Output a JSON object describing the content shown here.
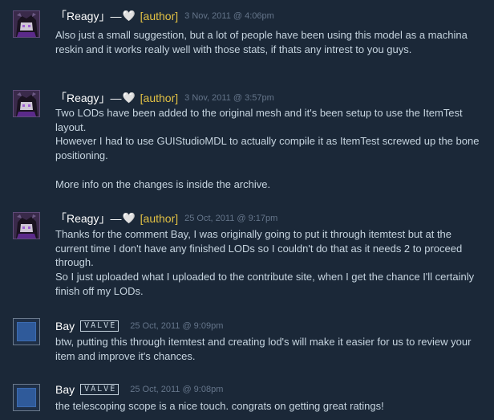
{
  "comments": [
    {
      "author": "「Reagy」―",
      "heart": "🤍",
      "tag": "[author]",
      "date": "3 Nov, 2011 @ 4:06pm",
      "text": "Also just a small suggestion, but a lot of people have been using this model as a machina reskin and it works really well with those stats, if thats any intrest to you guys."
    },
    {
      "author": "「Reagy」―",
      "heart": "🤍",
      "tag": "[author]",
      "date": "3 Nov, 2011 @ 3:57pm",
      "text": "Two LODs have been added to the original mesh and it's been setup to use the ItemTest layout.\nHowever I had to use GUIStudioMDL to actually compile it as ItemTest screwed up the bone positioning.\n\nMore info on the changes is inside the archive."
    },
    {
      "author": "「Reagy」―",
      "heart": "🤍",
      "tag": "[author]",
      "date": "25 Oct, 2011 @ 9:17pm",
      "text": "Thanks for the comment Bay, I was originally going to put it through itemtest but at the current time I don't have any finished LODs so I couldn't do that as it needs 2 to proceed through.\nSo I just uploaded what I uploaded to the contribute site, when I get the chance I'll certainly finish off my LODs."
    },
    {
      "author": "Bay",
      "badge": "VALVE",
      "date": "25 Oct, 2011 @ 9:09pm",
      "text": "btw, putting this through itemtest and creating lod's will make it easier for us to review your item and improve it's chances."
    },
    {
      "author": "Bay",
      "badge": "VALVE",
      "date": "25 Oct, 2011 @ 9:08pm",
      "text": "the telescoping scope is a nice touch. congrats on getting great ratings!"
    }
  ]
}
